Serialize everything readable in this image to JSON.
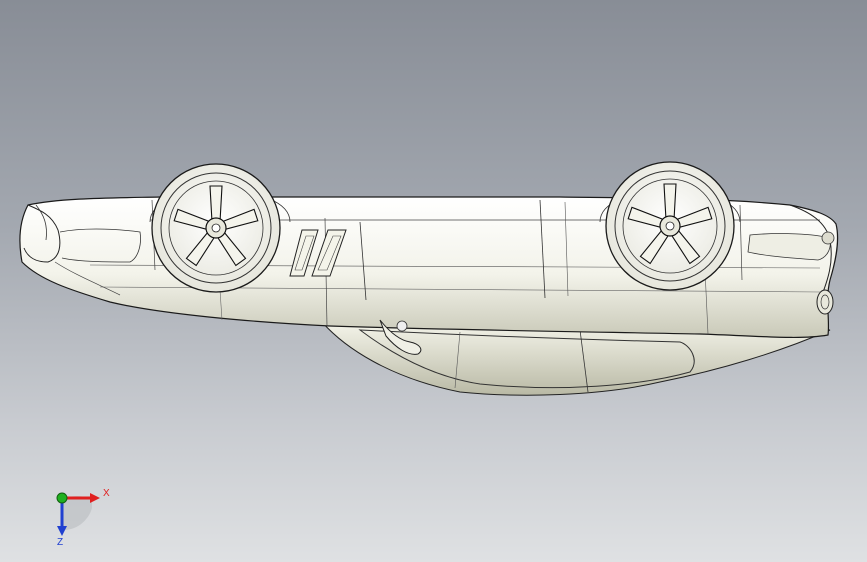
{
  "viewport": {
    "model_name": "car-body-inverted",
    "background_top": "#888d96",
    "background_bottom": "#dfe1e3"
  },
  "triad": {
    "x_label": "X",
    "z_label": "Z",
    "x_color": "#e02020",
    "y_color": "#20b020",
    "z_color": "#2040d0"
  }
}
